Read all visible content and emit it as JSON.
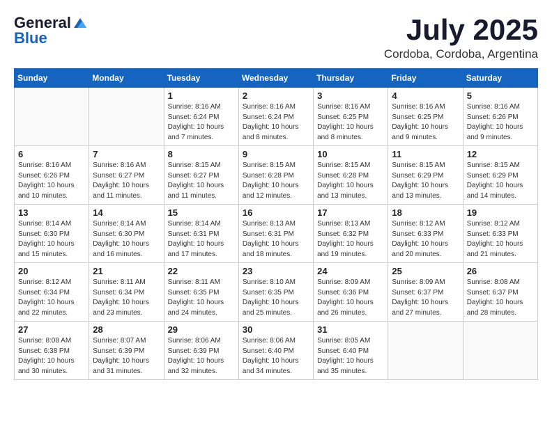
{
  "header": {
    "logo_general": "General",
    "logo_blue": "Blue",
    "month": "July 2025",
    "location": "Cordoba, Cordoba, Argentina"
  },
  "days_of_week": [
    "Sunday",
    "Monday",
    "Tuesday",
    "Wednesday",
    "Thursday",
    "Friday",
    "Saturday"
  ],
  "weeks": [
    [
      {
        "day": "",
        "info": ""
      },
      {
        "day": "",
        "info": ""
      },
      {
        "day": "1",
        "info": "Sunrise: 8:16 AM\nSunset: 6:24 PM\nDaylight: 10 hours and 7 minutes."
      },
      {
        "day": "2",
        "info": "Sunrise: 8:16 AM\nSunset: 6:24 PM\nDaylight: 10 hours and 8 minutes."
      },
      {
        "day": "3",
        "info": "Sunrise: 8:16 AM\nSunset: 6:25 PM\nDaylight: 10 hours and 8 minutes."
      },
      {
        "day": "4",
        "info": "Sunrise: 8:16 AM\nSunset: 6:25 PM\nDaylight: 10 hours and 9 minutes."
      },
      {
        "day": "5",
        "info": "Sunrise: 8:16 AM\nSunset: 6:26 PM\nDaylight: 10 hours and 9 minutes."
      }
    ],
    [
      {
        "day": "6",
        "info": "Sunrise: 8:16 AM\nSunset: 6:26 PM\nDaylight: 10 hours and 10 minutes."
      },
      {
        "day": "7",
        "info": "Sunrise: 8:16 AM\nSunset: 6:27 PM\nDaylight: 10 hours and 11 minutes."
      },
      {
        "day": "8",
        "info": "Sunrise: 8:15 AM\nSunset: 6:27 PM\nDaylight: 10 hours and 11 minutes."
      },
      {
        "day": "9",
        "info": "Sunrise: 8:15 AM\nSunset: 6:28 PM\nDaylight: 10 hours and 12 minutes."
      },
      {
        "day": "10",
        "info": "Sunrise: 8:15 AM\nSunset: 6:28 PM\nDaylight: 10 hours and 13 minutes."
      },
      {
        "day": "11",
        "info": "Sunrise: 8:15 AM\nSunset: 6:29 PM\nDaylight: 10 hours and 13 minutes."
      },
      {
        "day": "12",
        "info": "Sunrise: 8:15 AM\nSunset: 6:29 PM\nDaylight: 10 hours and 14 minutes."
      }
    ],
    [
      {
        "day": "13",
        "info": "Sunrise: 8:14 AM\nSunset: 6:30 PM\nDaylight: 10 hours and 15 minutes."
      },
      {
        "day": "14",
        "info": "Sunrise: 8:14 AM\nSunset: 6:30 PM\nDaylight: 10 hours and 16 minutes."
      },
      {
        "day": "15",
        "info": "Sunrise: 8:14 AM\nSunset: 6:31 PM\nDaylight: 10 hours and 17 minutes."
      },
      {
        "day": "16",
        "info": "Sunrise: 8:13 AM\nSunset: 6:31 PM\nDaylight: 10 hours and 18 minutes."
      },
      {
        "day": "17",
        "info": "Sunrise: 8:13 AM\nSunset: 6:32 PM\nDaylight: 10 hours and 19 minutes."
      },
      {
        "day": "18",
        "info": "Sunrise: 8:12 AM\nSunset: 6:33 PM\nDaylight: 10 hours and 20 minutes."
      },
      {
        "day": "19",
        "info": "Sunrise: 8:12 AM\nSunset: 6:33 PM\nDaylight: 10 hours and 21 minutes."
      }
    ],
    [
      {
        "day": "20",
        "info": "Sunrise: 8:12 AM\nSunset: 6:34 PM\nDaylight: 10 hours and 22 minutes."
      },
      {
        "day": "21",
        "info": "Sunrise: 8:11 AM\nSunset: 6:34 PM\nDaylight: 10 hours and 23 minutes."
      },
      {
        "day": "22",
        "info": "Sunrise: 8:11 AM\nSunset: 6:35 PM\nDaylight: 10 hours and 24 minutes."
      },
      {
        "day": "23",
        "info": "Sunrise: 8:10 AM\nSunset: 6:35 PM\nDaylight: 10 hours and 25 minutes."
      },
      {
        "day": "24",
        "info": "Sunrise: 8:09 AM\nSunset: 6:36 PM\nDaylight: 10 hours and 26 minutes."
      },
      {
        "day": "25",
        "info": "Sunrise: 8:09 AM\nSunset: 6:37 PM\nDaylight: 10 hours and 27 minutes."
      },
      {
        "day": "26",
        "info": "Sunrise: 8:08 AM\nSunset: 6:37 PM\nDaylight: 10 hours and 28 minutes."
      }
    ],
    [
      {
        "day": "27",
        "info": "Sunrise: 8:08 AM\nSunset: 6:38 PM\nDaylight: 10 hours and 30 minutes."
      },
      {
        "day": "28",
        "info": "Sunrise: 8:07 AM\nSunset: 6:39 PM\nDaylight: 10 hours and 31 minutes."
      },
      {
        "day": "29",
        "info": "Sunrise: 8:06 AM\nSunset: 6:39 PM\nDaylight: 10 hours and 32 minutes."
      },
      {
        "day": "30",
        "info": "Sunrise: 8:06 AM\nSunset: 6:40 PM\nDaylight: 10 hours and 34 minutes."
      },
      {
        "day": "31",
        "info": "Sunrise: 8:05 AM\nSunset: 6:40 PM\nDaylight: 10 hours and 35 minutes."
      },
      {
        "day": "",
        "info": ""
      },
      {
        "day": "",
        "info": ""
      }
    ]
  ]
}
